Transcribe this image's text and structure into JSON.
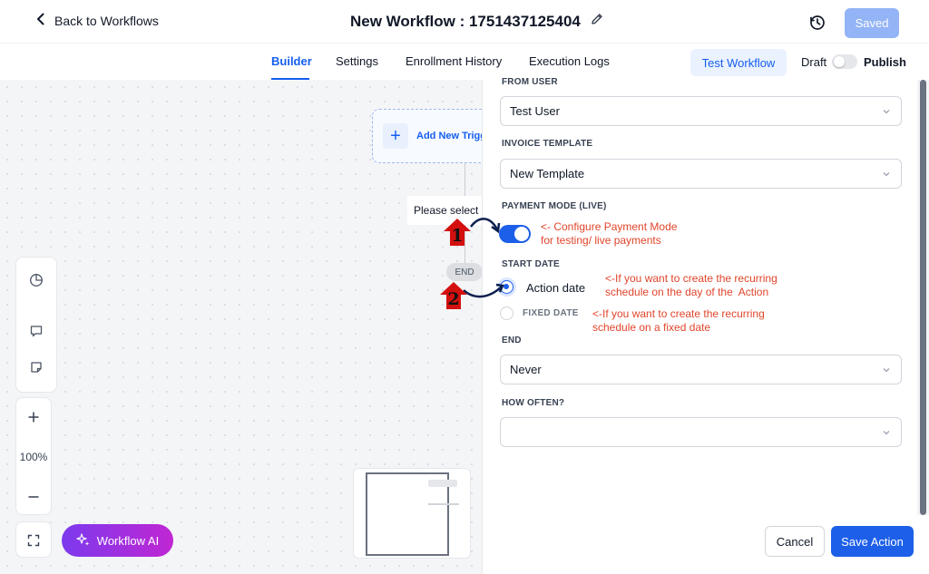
{
  "header": {
    "back_label": "Back to Workflows",
    "title": "New Workflow : 1751437125404",
    "saved_label": "Saved"
  },
  "tabs": [
    {
      "label": "Builder",
      "active": true
    },
    {
      "label": "Settings",
      "active": false
    },
    {
      "label": "Enrollment History",
      "active": false
    },
    {
      "label": "Execution Logs",
      "active": false
    }
  ],
  "toolbar": {
    "test_label": "Test Workflow",
    "draft_label": "Draft",
    "publish_label": "Publish",
    "publish_enabled": false
  },
  "canvas": {
    "trigger_label": "Add New Trigger",
    "please_select": "Please select an action",
    "end_label": "END",
    "zoom": "100%",
    "ai_label": "Workflow AI"
  },
  "panel": {
    "from_user_label": "FROM USER",
    "from_user_value": "Test User",
    "invoice_template_label": "INVOICE TEMPLATE",
    "invoice_template_value": "New Template",
    "payment_mode_label": "PAYMENT MODE (LIVE)",
    "payment_mode_on": true,
    "start_date_label": "START DATE",
    "start_date_options": [
      {
        "label": "Action date",
        "selected": true
      },
      {
        "label": "FIXED DATE",
        "selected": false
      }
    ],
    "end_label": "END",
    "end_value": "Never",
    "how_often_label": "HOW OFTEN?",
    "how_often_value": "",
    "cancel_label": "Cancel",
    "save_label": "Save Action"
  },
  "annotations": {
    "badge_1": "1",
    "badge_2": "2",
    "note_payment": "<- Configure Payment Mode\nfor testing/ live payments",
    "note_action_date": "<-If you want to create the recurring\nschedule on the day of the  Action",
    "note_fixed_date": "<-If you want to create the recurring\nschedule on a fixed date"
  },
  "colors": {
    "accent": "#1d5fe8",
    "saved_button": "#93b4f6",
    "annotation_red": "#e0452b",
    "ai_gradient_start": "#7c3aed",
    "ai_gradient_end": "#c026d3"
  }
}
